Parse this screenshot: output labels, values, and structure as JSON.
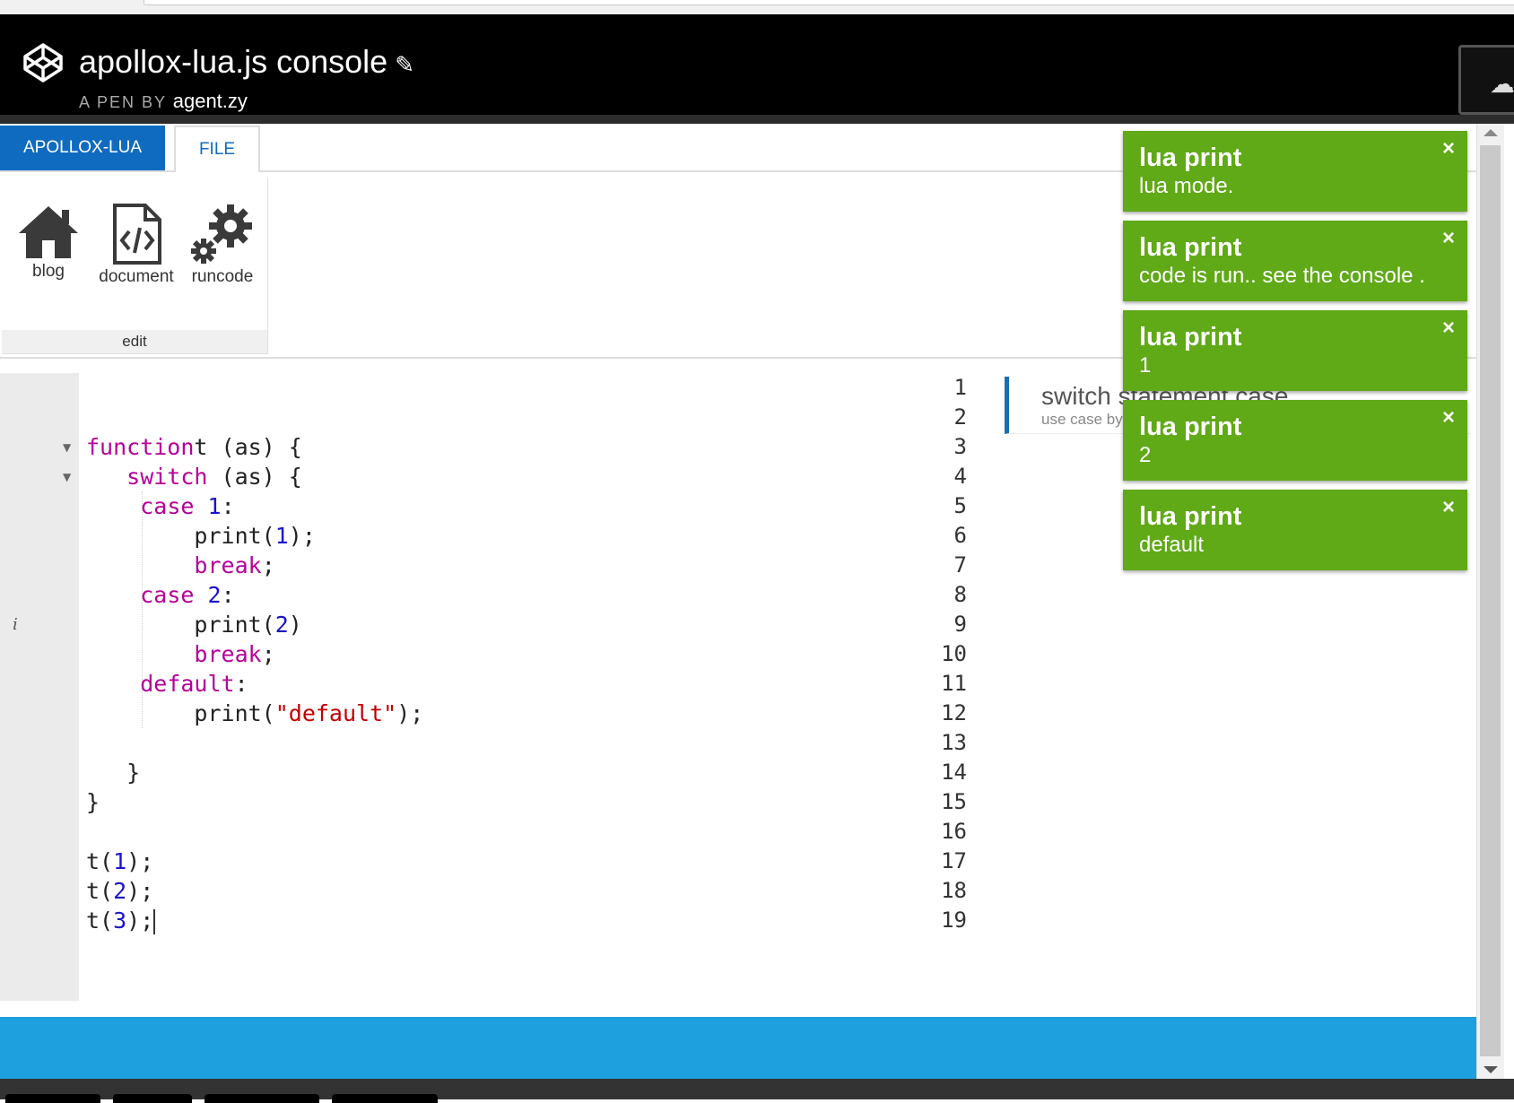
{
  "header": {
    "title": "apollox-lua.js console",
    "by_label": "A PEN BY",
    "author": "agent.zy"
  },
  "ribbon": {
    "tabs": [
      {
        "label": "APOLLOX-LUA"
      },
      {
        "label": "FILE"
      }
    ],
    "buttons": [
      {
        "label": "blog",
        "icon": "home-icon"
      },
      {
        "label": "document",
        "icon": "code-file-icon"
      },
      {
        "label": "runcode",
        "icon": "gears-icon"
      }
    ],
    "group_label": "edit"
  },
  "editor": {
    "line_numbers": [
      "1",
      "2",
      "3",
      "4",
      "5",
      "6",
      "7",
      "8",
      "9",
      "10",
      "11",
      "12",
      "13",
      "14",
      "15",
      "16",
      "17",
      "18",
      "19"
    ],
    "active_line": 19
  },
  "docs_panel": {
    "title": "switch statement case",
    "subtitle": "use case by"
  },
  "toasts": [
    {
      "title": "lua print",
      "body": "lua mode.",
      "close": "×"
    },
    {
      "title": "lua print",
      "body": "code is run.. see the console .",
      "close": "×"
    },
    {
      "title": "lua print",
      "body": "1",
      "close": "×"
    },
    {
      "title": "lua print",
      "body": "2",
      "close": "×"
    },
    {
      "title": "lua print",
      "body": "default",
      "close": "×"
    }
  ],
  "colors": {
    "header_bg": "#000000",
    "ribbon_tab_active": "#0f6bbf",
    "status_bar": "#1ea0de",
    "toast_bg": "#60a917",
    "keyword": "#b5009a",
    "number": "#1a13cc",
    "string": "#c20000"
  }
}
